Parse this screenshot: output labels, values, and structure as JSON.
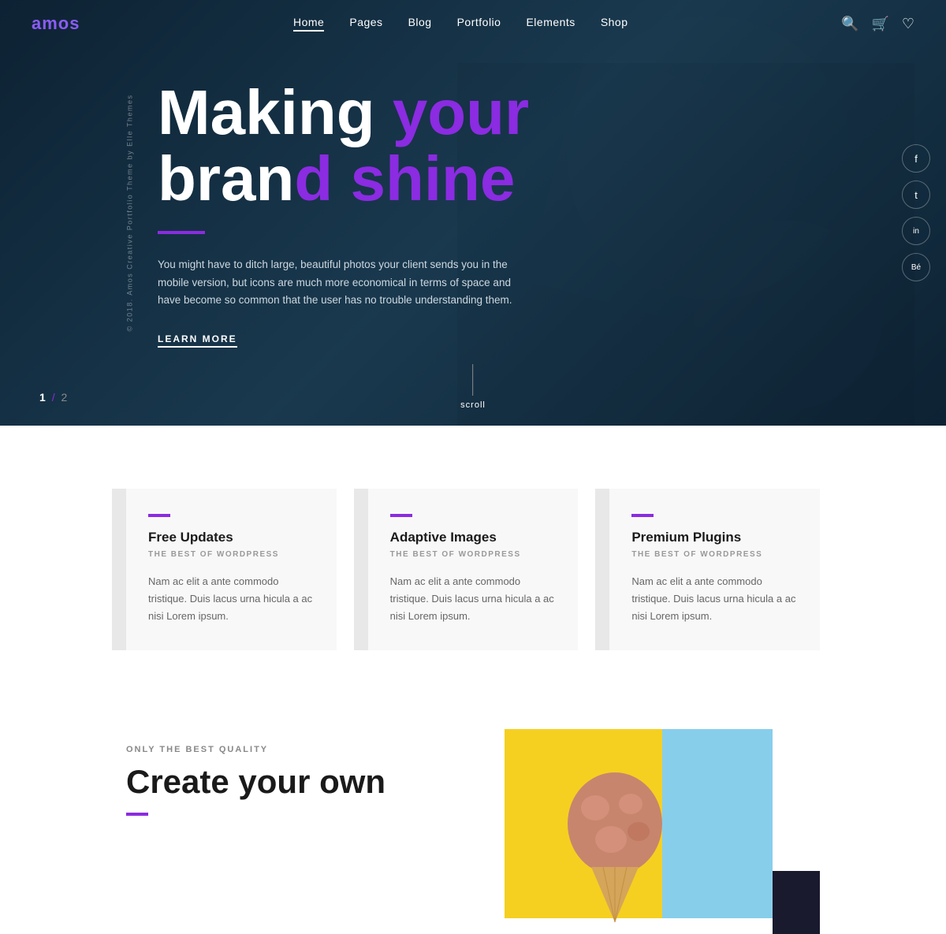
{
  "logo": {
    "text_before": "am",
    "accent": "o",
    "text_after": "s"
  },
  "nav": {
    "items": [
      {
        "label": "Home",
        "active": true
      },
      {
        "label": "Pages",
        "active": false
      },
      {
        "label": "Blog",
        "active": false
      },
      {
        "label": "Portfolio",
        "active": false
      },
      {
        "label": "Elements",
        "active": false
      },
      {
        "label": "Shop",
        "active": false
      }
    ]
  },
  "hero": {
    "headline_white_1": "Making your",
    "headline_white_2": "bran",
    "headline_purple_1": "g your",
    "headline_purple_2": "d shine",
    "description": "You might have to ditch large, beautiful photos your client sends you in the mobile version, but icons are much more economical in terms of space and have become so common that the user has no trouble understanding them.",
    "learn_more": "LEARN MORE",
    "slide_current": "1",
    "slide_separator": "/",
    "slide_total": "2",
    "scroll_label": "scroll"
  },
  "social": [
    {
      "icon": "f",
      "name": "facebook"
    },
    {
      "icon": "t",
      "name": "twitter"
    },
    {
      "icon": "in",
      "name": "linkedin"
    },
    {
      "icon": "Be",
      "name": "behance"
    }
  ],
  "vertical_text": "© 2018. Amos Creative Portfolio Theme by Elle Themes",
  "features": {
    "items": [
      {
        "title": "Free Updates",
        "subtitle": "THE BEST OF WORDPRESS",
        "description": "Nam ac elit a ante commodo tristique. Duis lacus urna hicula a ac nisi Lorem ipsum."
      },
      {
        "title": "Adaptive Images",
        "subtitle": "THE BEST OF WORDPRESS",
        "description": "Nam ac elit a ante commodo tristique. Duis lacus urna hicula a ac nisi Lorem ipsum."
      },
      {
        "title": "Premium Plugins",
        "subtitle": "THE BEST OF WORDPRESS",
        "description": "Nam ac elit a ante commodo tristique. Duis lacus urna hicula a ac nisi Lorem ipsum."
      }
    ]
  },
  "bottom": {
    "label": "ONLY THE BEST QUALITY",
    "heading": "Create your own"
  }
}
